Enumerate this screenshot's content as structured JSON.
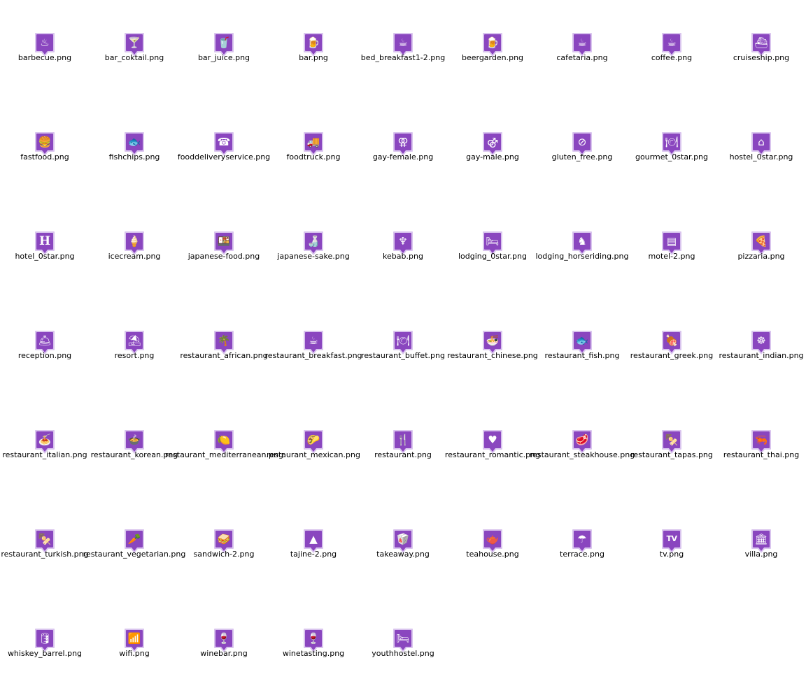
{
  "colors": {
    "marker_fill": "#8a46bf",
    "marker_border": "#6b2f9c",
    "marker_glow": "#d9c4ee",
    "glyph": "#ffffff",
    "label": "#000000",
    "background": "#ffffff"
  },
  "icons": [
    {
      "filename": "barbecue.png",
      "icon": "barbecue-icon",
      "glyph": "♨"
    },
    {
      "filename": "bar_coktail.png",
      "icon": "cocktail-icon",
      "glyph": "🍸"
    },
    {
      "filename": "bar_juice.png",
      "icon": "juice-icon",
      "glyph": "🥤"
    },
    {
      "filename": "bar.png",
      "icon": "beer-mug-icon",
      "glyph": "🍺"
    },
    {
      "filename": "bed_breakfast1-2.png",
      "icon": "bed-breakfast-icon",
      "glyph": "☕"
    },
    {
      "filename": "beergarden.png",
      "icon": "beergarden-icon",
      "glyph": "🍺"
    },
    {
      "filename": "cafetaria.png",
      "icon": "cafetaria-icon",
      "glyph": "☕"
    },
    {
      "filename": "coffee.png",
      "icon": "coffee-cup-icon",
      "glyph": "☕"
    },
    {
      "filename": "cruiseship.png",
      "icon": "cruiseship-icon",
      "glyph": "⛴"
    },
    {
      "filename": "fastfood.png",
      "icon": "fastfood-icon",
      "glyph": "🍔"
    },
    {
      "filename": "fishchips.png",
      "icon": "fishchips-icon",
      "glyph": "🐟"
    },
    {
      "filename": "fooddeliveryservice.png",
      "icon": "food-delivery-icon",
      "glyph": "☎"
    },
    {
      "filename": "foodtruck.png",
      "icon": "foodtruck-icon",
      "glyph": "🚚"
    },
    {
      "filename": "gay-female.png",
      "icon": "female-symbol-icon",
      "glyph": "⚢"
    },
    {
      "filename": "gay-male.png",
      "icon": "male-symbol-icon",
      "glyph": "⚣"
    },
    {
      "filename": "gluten_free.png",
      "icon": "gluten-free-icon",
      "glyph": "⊘"
    },
    {
      "filename": "gourmet_0star.png",
      "icon": "cloche-icon",
      "glyph": "🍽"
    },
    {
      "filename": "hostel_0star.png",
      "icon": "hostel-icon",
      "glyph": "⌂"
    },
    {
      "filename": "hotel_0star.png",
      "icon": "hotel-h-icon",
      "glyph": "H"
    },
    {
      "filename": "icecream.png",
      "icon": "icecream-icon",
      "glyph": "🍦"
    },
    {
      "filename": "japanese-food.png",
      "icon": "japanese-food-icon",
      "glyph": "🍱"
    },
    {
      "filename": "japanese-sake.png",
      "icon": "sake-icon",
      "glyph": "🍶"
    },
    {
      "filename": "kebab.png",
      "icon": "kebab-icon",
      "glyph": "♆"
    },
    {
      "filename": "lodging_0star.png",
      "icon": "lodging-icon",
      "glyph": "🛏"
    },
    {
      "filename": "lodging_horseriding.png",
      "icon": "horseriding-icon",
      "glyph": "♞"
    },
    {
      "filename": "motel-2.png",
      "icon": "motel-icon",
      "glyph": "▤"
    },
    {
      "filename": "pizzaria.png",
      "icon": "pizza-icon",
      "glyph": "🍕"
    },
    {
      "filename": "reception.png",
      "icon": "reception-icon",
      "glyph": "🛎"
    },
    {
      "filename": "resort.png",
      "icon": "resort-icon",
      "glyph": "⛱"
    },
    {
      "filename": "restaurant_african.png",
      "icon": "african-restaurant-icon",
      "glyph": "🌴"
    },
    {
      "filename": "restaurant_breakfast.png",
      "icon": "breakfast-icon",
      "glyph": "☕"
    },
    {
      "filename": "restaurant_buffet.png",
      "icon": "buffet-icon",
      "glyph": "🍽"
    },
    {
      "filename": "restaurant_chinese.png",
      "icon": "chinese-bowl-icon",
      "glyph": "🍜"
    },
    {
      "filename": "restaurant_fish.png",
      "icon": "fish-icon",
      "glyph": "🐟"
    },
    {
      "filename": "restaurant_greek.png",
      "icon": "greek-restaurant-icon",
      "glyph": "🍖"
    },
    {
      "filename": "restaurant_indian.png",
      "icon": "indian-restaurant-icon",
      "glyph": "☸"
    },
    {
      "filename": "restaurant_italian.png",
      "icon": "italian-restaurant-icon",
      "glyph": "🍝"
    },
    {
      "filename": "restaurant_korean.png",
      "icon": "korean-restaurant-icon",
      "glyph": "🍲"
    },
    {
      "filename": "restaurant_mediterranean.png",
      "icon": "mediterranean-restaurant-icon",
      "glyph": "🍋"
    },
    {
      "filename": "restaurant_mexican.png",
      "icon": "sombrero-icon",
      "glyph": "🌮"
    },
    {
      "filename": "restaurant.png",
      "icon": "fork-knife-icon",
      "glyph": "🍴"
    },
    {
      "filename": "restaurant_romantic.png",
      "icon": "romantic-restaurant-icon",
      "glyph": "♥"
    },
    {
      "filename": "restaurant_steakhouse.png",
      "icon": "steak-icon",
      "glyph": "🥩"
    },
    {
      "filename": "restaurant_tapas.png",
      "icon": "tapas-icon",
      "glyph": "🍢"
    },
    {
      "filename": "restaurant_thai.png",
      "icon": "thai-restaurant-icon",
      "glyph": "🦐"
    },
    {
      "filename": "restaurant_turkish.png",
      "icon": "turkish-skewer-icon",
      "glyph": "🍢"
    },
    {
      "filename": "restaurant_vegetarian.png",
      "icon": "carrot-icon",
      "glyph": "🥕"
    },
    {
      "filename": "sandwich-2.png",
      "icon": "sandwich-icon",
      "glyph": "🥪"
    },
    {
      "filename": "tajine-2.png",
      "icon": "tajine-icon",
      "glyph": "▲"
    },
    {
      "filename": "takeaway.png",
      "icon": "takeaway-icon",
      "glyph": "🥡"
    },
    {
      "filename": "teahouse.png",
      "icon": "teapot-icon",
      "glyph": "🫖"
    },
    {
      "filename": "terrace.png",
      "icon": "terrace-icon",
      "glyph": "☂"
    },
    {
      "filename": "tv.png",
      "icon": "tv-icon",
      "glyph": "TV"
    },
    {
      "filename": "villa.png",
      "icon": "villa-icon",
      "glyph": "🏛"
    },
    {
      "filename": "whiskey_barrel.png",
      "icon": "barrel-icon",
      "glyph": "🛢"
    },
    {
      "filename": "wifi.png",
      "icon": "wifi-icon",
      "glyph": "📶"
    },
    {
      "filename": "winebar.png",
      "icon": "wine-bottle-icon",
      "glyph": "🍷"
    },
    {
      "filename": "winetasting.png",
      "icon": "winetasting-icon",
      "glyph": "🍷"
    },
    {
      "filename": "youthhostel.png",
      "icon": "bunkbed-icon",
      "glyph": "🛏"
    }
  ]
}
